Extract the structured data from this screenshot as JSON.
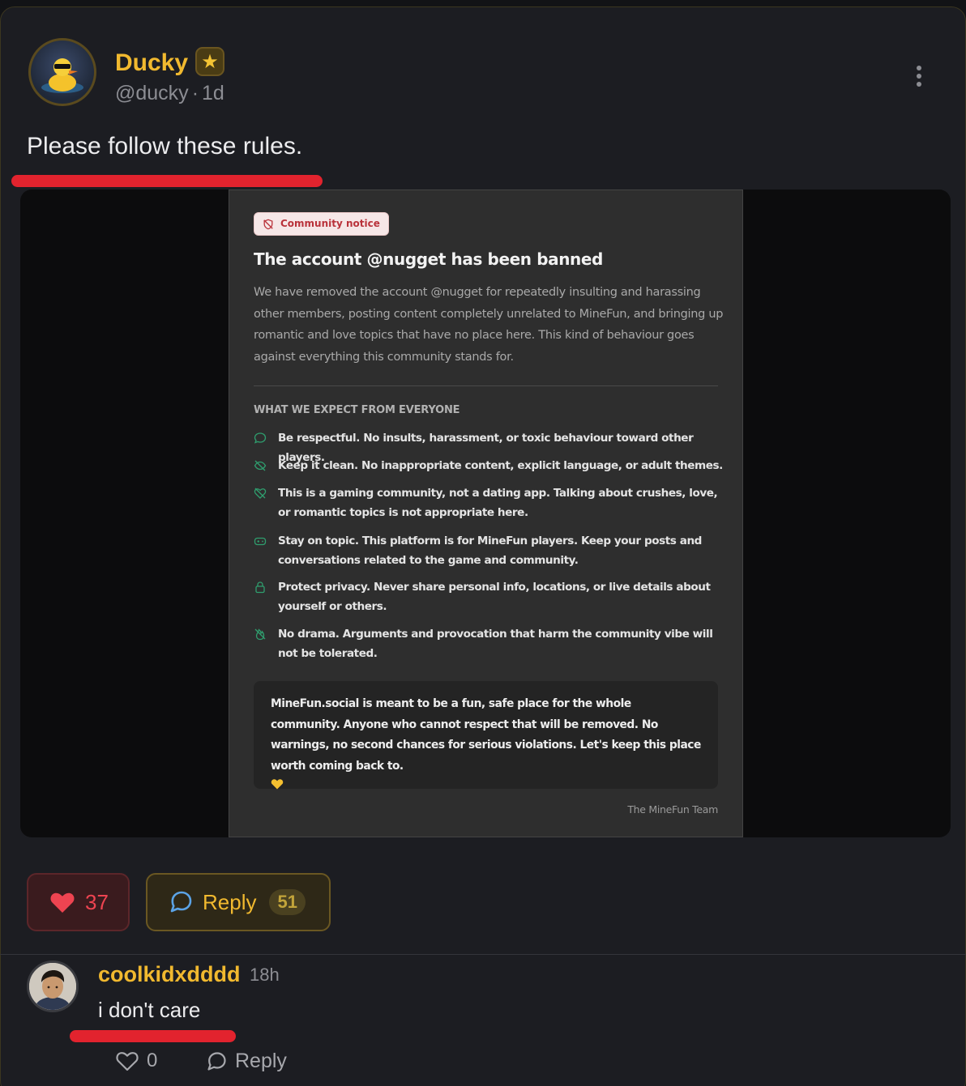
{
  "post": {
    "author_name": "Ducky",
    "author_handle": "@ducky",
    "time_ago": "1d",
    "text": "Please follow these rules.",
    "likes": "37",
    "reply_label": "Reply",
    "reply_count": "51"
  },
  "notice": {
    "badge": "Community notice",
    "title": "The account @nugget has been banned",
    "body": "We have removed the account @nugget for repeatedly insulting and harassing other members, posting content completely unrelated to MineFun, and bringing up romantic and love topics that have no place here. This kind of behaviour goes against everything this community stands for.",
    "section_heading": "WHAT WE EXPECT FROM EVERYONE",
    "rules": [
      {
        "icon": "chat-bubble-icon",
        "text": "Be respectful. No insults, harassment, or toxic behaviour toward other players."
      },
      {
        "icon": "eye-off-icon",
        "text": "Keep it clean. No inappropriate content, explicit language, or adult themes."
      },
      {
        "icon": "heart-off-icon",
        "text": "This is a gaming community, not a dating app. Talking about crushes, love, or romantic topics is not appropriate here."
      },
      {
        "icon": "gamepad-icon",
        "text": "Stay on topic. This platform is for MineFun players. Keep your posts and conversations related to the game and community."
      },
      {
        "icon": "lock-icon",
        "text": "Protect privacy. Never share personal info, locations, or live details about yourself or others."
      },
      {
        "icon": "flame-off-icon",
        "text": "No drama. Arguments and provocation that harm the community vibe will not be tolerated."
      }
    ],
    "closing": "MineFun.social is meant to be a fun, safe place for the whole community. Anyone who cannot respect that will be removed. No warnings, no second chances for serious violations. Let's keep this place worth coming back to.",
    "signature": "The MineFun Team"
  },
  "comment": {
    "author_name": "coolkidxdddd",
    "time_ago": "18h",
    "text": "i don't care",
    "likes": "0",
    "reply_label": "Reply"
  },
  "colors": {
    "accent": "#f1b92f",
    "like": "#ee4451",
    "highlight_underline": "#e2232e",
    "rule_icon": "#2f9e6e"
  }
}
